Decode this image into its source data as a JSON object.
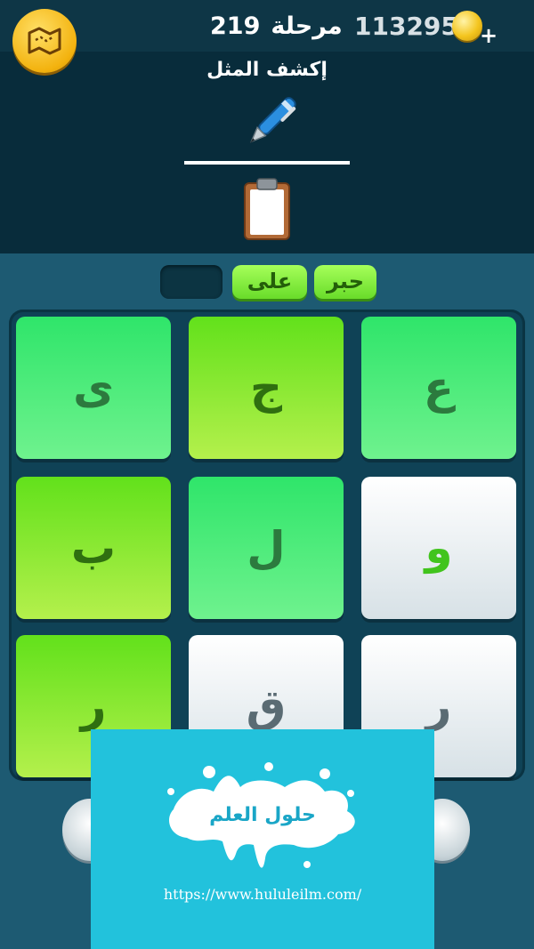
{
  "header": {
    "level_label": "مرحلة",
    "level_number": "219",
    "coins": "1132955"
  },
  "puzzle": {
    "prompt": "إكشف المثل",
    "hint_icons": [
      "pen-icon",
      "clipboard-icon"
    ]
  },
  "found_words": [
    "حبر",
    "على",
    ""
  ],
  "letter_grid": [
    [
      {
        "letter": "ع",
        "color": "green"
      },
      {
        "letter": "ج",
        "color": "lime"
      },
      {
        "letter": "ى",
        "color": "green"
      }
    ],
    [
      {
        "letter": "و",
        "color": "white"
      },
      {
        "letter": "ل",
        "color": "green"
      },
      {
        "letter": "ب",
        "color": "lime"
      }
    ],
    [
      {
        "letter": "ر",
        "color": "white"
      },
      {
        "letter": "ق",
        "color": "white"
      },
      {
        "letter": "ر",
        "color": "lime"
      }
    ]
  ],
  "watermark": {
    "brand": "حلول العلم",
    "url": "https://www.hululeilm.com/"
  },
  "colors": {
    "tile_green": "#2fe56a",
    "tile_lime": "#8fe832",
    "tile_white": "#eef3f5",
    "coin_gold": "#f4c51e",
    "overlay_cyan": "#22c2dc"
  }
}
